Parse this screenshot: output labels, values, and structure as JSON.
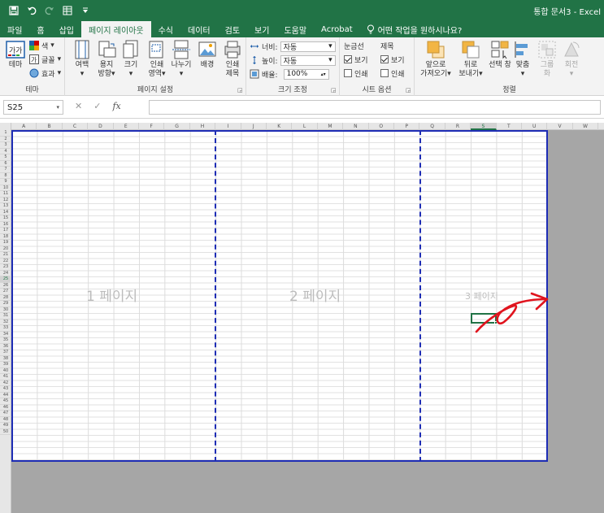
{
  "titlebar": {
    "title": "통합 문서3  -  Excel",
    "qa_icons": [
      "save-icon",
      "undo-icon",
      "redo-icon",
      "form-icon",
      "customize-icon"
    ]
  },
  "tabs": [
    {
      "label": "파일"
    },
    {
      "label": "홈"
    },
    {
      "label": "삽입"
    },
    {
      "label": "페이지 레이아웃",
      "active": true
    },
    {
      "label": "수식"
    },
    {
      "label": "데이터"
    },
    {
      "label": "검토"
    },
    {
      "label": "보기"
    },
    {
      "label": "도움말"
    },
    {
      "label": "Acrobat"
    }
  ],
  "search": {
    "label": "어떤 작업을 원하시나요?"
  },
  "ribbon": {
    "themes": {
      "label": "테마",
      "big": "테마",
      "color": "색",
      "font": "글꼴",
      "effect": "효과"
    },
    "page_setup": {
      "label": "페이지 설정",
      "margins": "여백",
      "orientation": "용지\n방향",
      "size": "크기",
      "print_area": "인쇄\n영역",
      "breaks": "나누기",
      "background": "배경",
      "print_titles": "인쇄\n제목"
    },
    "scale": {
      "label": "크기 조정",
      "width_label": "너비:",
      "width_value": "자동",
      "height_label": "높이:",
      "height_value": "자동",
      "scale_label": "배율:",
      "scale_value": "100%"
    },
    "sheet_options": {
      "label": "시트 옵션",
      "gridlines": "눈금선",
      "headings": "제목",
      "view": "보기",
      "print": "인쇄",
      "gridlines_view": true,
      "gridlines_print": false,
      "headings_view": true,
      "headings_print": false
    },
    "arrange": {
      "label": "정렬",
      "bring_forward": "앞으로\n가져오기",
      "send_backward": "뒤로\n보내기",
      "selection_pane": "선택 창",
      "align": "맞춤",
      "group": "그룹\n화",
      "rotate": "회전"
    }
  },
  "formula_bar": {
    "name_box": "S25",
    "formula": ""
  },
  "columns": [
    "A",
    "B",
    "C",
    "D",
    "E",
    "F",
    "G",
    "H",
    "I",
    "J",
    "K",
    "L",
    "M",
    "N",
    "O",
    "P",
    "Q",
    "R",
    "S",
    "T",
    "U",
    "V",
    "W"
  ],
  "selected_column": "S",
  "selected_row": 25,
  "row_count": 50,
  "pages": [
    {
      "label": "1 페이지"
    },
    {
      "label": "2 페이지"
    },
    {
      "label": "3 페이지"
    }
  ],
  "colors": {
    "excel_green": "#217346",
    "page_break": "#1e2db5",
    "annotation": "#e0141e"
  }
}
